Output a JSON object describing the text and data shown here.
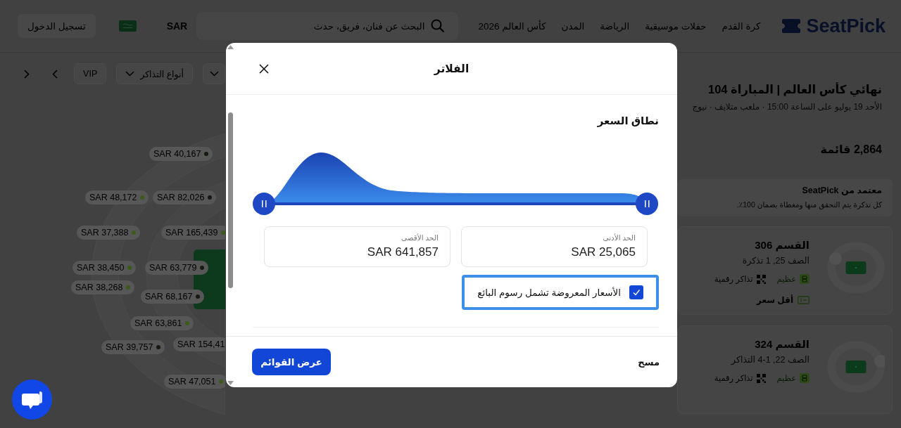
{
  "header": {
    "logo": "SeatPick",
    "nav": [
      "كرة القدم",
      "حفلات موسيقية",
      "الرياضة",
      "المدن",
      "كأس العالم 2026"
    ],
    "search": {
      "placeholder": "البحث عن فنان، فريق، حدث"
    },
    "currency": "SAR",
    "login": "تسجيل الدخول"
  },
  "map_panel": {
    "filters": [
      {
        "kind": "dropdown"
      },
      {
        "kind": "dropdown",
        "label": "أنواع التذاكر"
      },
      {
        "kind": "toggle",
        "label": "VIP"
      }
    ],
    "price_pins": [
      {
        "price": "SAR 40,167",
        "color": "#161a12"
      },
      {
        "price": "SAR 48,172",
        "color": "#3b5a1c"
      },
      {
        "price": "SAR 82,026",
        "color": "#161a12"
      },
      {
        "price": "SAR 37,388",
        "color": "#3b5a1c"
      },
      {
        "price": "SAR 165,439",
        "color": "#3b5a1c"
      },
      {
        "price": "SAR 38,450",
        "color": "#3b5a1c"
      },
      {
        "price": "SAR 63,779",
        "color": "#161a12"
      },
      {
        "price": "SAR 38,268",
        "color": "#3b5a1c"
      },
      {
        "price": "SAR 68,167",
        "color": "#161a12"
      },
      {
        "price": "SAR 63,861",
        "color": "#3b5a1c"
      },
      {
        "price": "SAR 39,757",
        "color": "#161a12"
      },
      {
        "price": "SAR 154,41"
      },
      {
        "price": "SAR 47,051",
        "color": "#3b5a1c"
      }
    ]
  },
  "event": {
    "title": "نهائي كأس العالم | المباراة 104",
    "details": "الأحد 19 يوليو على الساعة 15:00 · ملعب متلايف · نيوج",
    "listing_count": "2,864 قائمة",
    "verified": {
      "title": "معتمد من SeatPick",
      "text": "كل تذكرة يتم التحقق منها ومغطاة بضمان 100٪."
    },
    "listings": [
      {
        "section": "القسم 306",
        "row": "الصف 25, 1 تذكرة",
        "features": [
          {
            "kind": "rating",
            "label": "عظيم"
          },
          {
            "kind": "digital",
            "label": "تذاكر رقمية"
          }
        ],
        "badge": "أقل سعر"
      },
      {
        "section": "القسم 324",
        "row": "الصف 22, 1-4 التذاكر",
        "features": [
          {
            "kind": "rating",
            "label": "عظيم"
          },
          {
            "kind": "digital",
            "label": "تذاكر رقمية"
          }
        ]
      }
    ]
  },
  "filters_modal": {
    "title": "الفلاتر",
    "price_range": {
      "heading": "نطاق السعر",
      "thumbs": [
        {
          "level": 0
        },
        {
          "level": 1
        }
      ],
      "min": {
        "label": "الحد الأدنى",
        "value": "SAR 25,065"
      },
      "max": {
        "label": "الحد الأقصى",
        "value": "SAR 641,857"
      }
    },
    "fees_checkbox": {
      "label": "الأسعار المعروضة تشمل رسوم البائع",
      "checked": true,
      "focused": true
    },
    "clear": "مسح",
    "apply": "عرض القوائم"
  }
}
